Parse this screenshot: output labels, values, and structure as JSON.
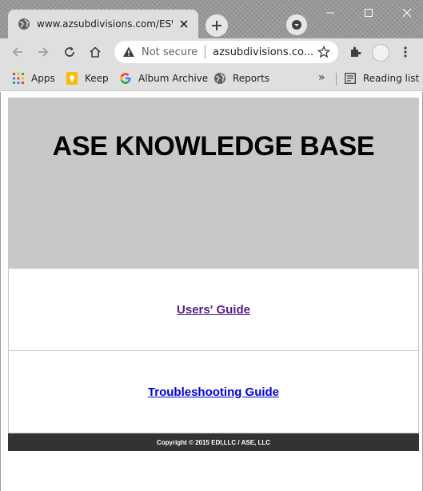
{
  "browser": {
    "tab": {
      "title": "www.azsubdivisions.com/ESW/FH",
      "favicon": "globe-icon"
    },
    "omnibox": {
      "security_label": "Not secure",
      "url": "azsubdivisions.co..."
    },
    "bookmarks": [
      {
        "label": "Apps",
        "icon": "apps-grid-icon"
      },
      {
        "label": "Keep",
        "icon": "keep-icon"
      },
      {
        "label": "Album Archive",
        "icon": "google-icon"
      },
      {
        "label": "Reports",
        "icon": "globe-icon"
      }
    ],
    "bookmarks_overflow": "»",
    "reading_list": "Reading list"
  },
  "page": {
    "heading": "ASE KNOWLEDGE BASE",
    "links": [
      {
        "label": "Users' Guide",
        "visited": true
      },
      {
        "label": "Troubleshooting Guide",
        "visited": false
      }
    ],
    "footer": "Copyright © 2015 EDI,LLC / ASE, LLC"
  },
  "colors": {
    "hero_bg": "#c8c8c8",
    "footer_bg": "#333333",
    "visited_link": "#551a8b",
    "unvisited_link": "#0000ee"
  }
}
